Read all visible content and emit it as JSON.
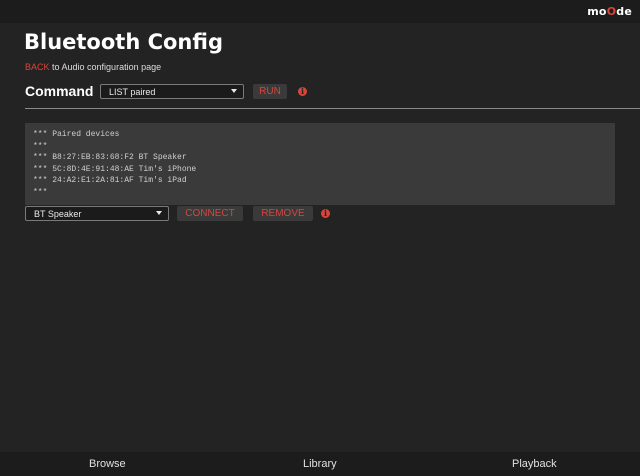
{
  "app": {
    "logo_a": "mo",
    "logo_b": "O",
    "logo_c": "de"
  },
  "page": {
    "title": "Bluetooth Config",
    "back_link": "BACK",
    "back_text": " to Audio configuration page"
  },
  "command": {
    "label": "Command",
    "selected": "LIST paired",
    "run_label": "RUN",
    "info_glyph": "i"
  },
  "output": {
    "lines": [
      "*** Paired devices",
      "***",
      "*** B8:27:EB:83:68:F2 BT Speaker",
      "*** 5C:8D:4E:91:48:AE Tim's iPhone",
      "*** 24:A2:E1:2A:81:AF Tim's iPad",
      "***"
    ]
  },
  "device": {
    "selected": "BT Speaker",
    "connect_label": "CONNECT",
    "remove_label": "REMOVE",
    "info_glyph": "i"
  },
  "bottom_nav": {
    "browse": "Browse",
    "library": "Library",
    "playback": "Playback"
  },
  "colors": {
    "accent": "#d8453b",
    "background": "#232323",
    "panel": "#3a3a3a"
  }
}
